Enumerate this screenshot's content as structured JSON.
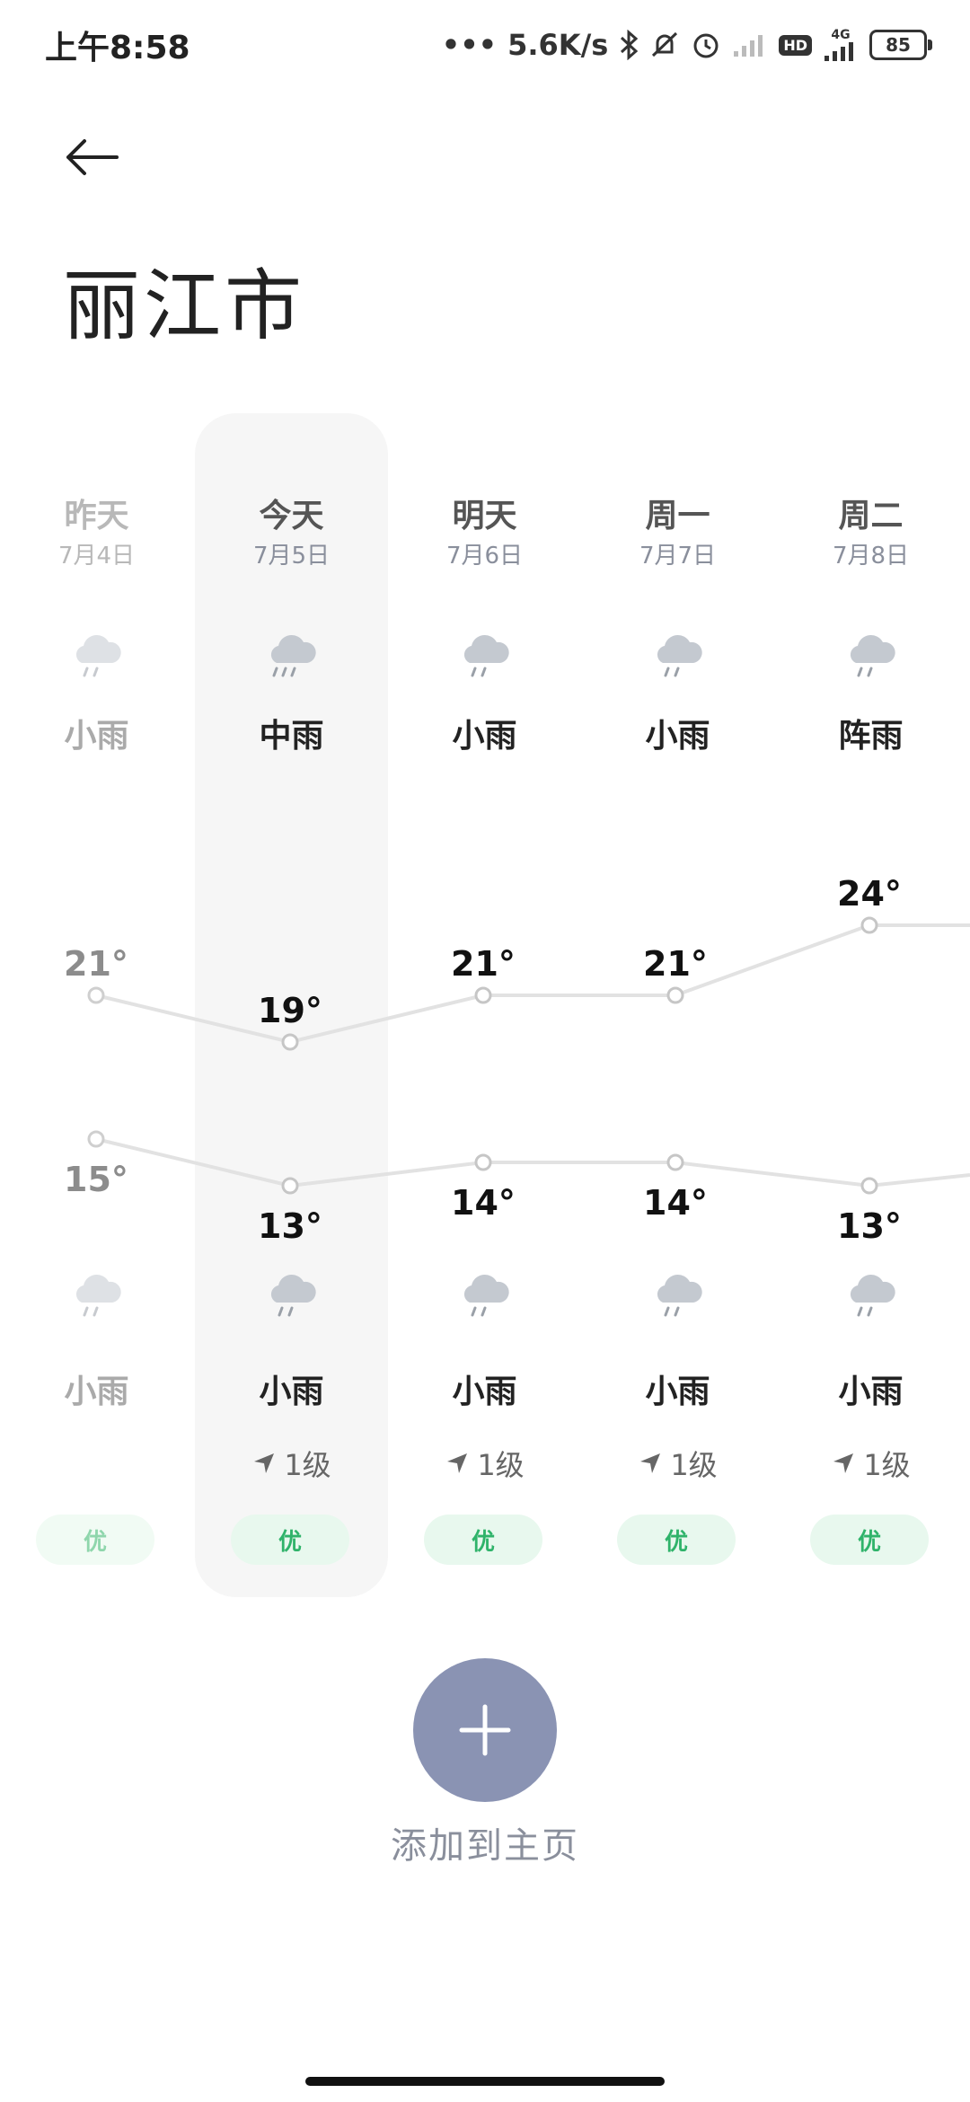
{
  "status_bar": {
    "time": "上午8:58",
    "speed": "5.6K/s",
    "hd": "HD",
    "network": "4G",
    "battery": "85"
  },
  "header": {
    "back_icon": "arrow-left-icon",
    "city": "丽江市"
  },
  "days": [
    {
      "name": "昨天",
      "date": "7月4日",
      "day_weather": "小雨",
      "high": "21°",
      "low": "15°",
      "night_weather": "小雨",
      "wind": "",
      "aqi": "优",
      "icon": "light-rain-icon"
    },
    {
      "name": "今天",
      "date": "7月5日",
      "day_weather": "中雨",
      "high": "19°",
      "low": "13°",
      "night_weather": "小雨",
      "wind": "1级",
      "aqi": "优",
      "icon": "moderate-rain-icon"
    },
    {
      "name": "明天",
      "date": "7月6日",
      "day_weather": "小雨",
      "high": "21°",
      "low": "14°",
      "night_weather": "小雨",
      "wind": "1级",
      "aqi": "优",
      "icon": "light-rain-icon"
    },
    {
      "name": "周一",
      "date": "7月7日",
      "day_weather": "小雨",
      "high": "21°",
      "low": "14°",
      "night_weather": "小雨",
      "wind": "1级",
      "aqi": "优",
      "icon": "light-rain-icon"
    },
    {
      "name": "周二",
      "date": "7月8日",
      "day_weather": "阵雨",
      "high": "24°",
      "low": "13°",
      "night_weather": "小雨",
      "wind": "1级",
      "aqi": "优",
      "icon": "shower-icon"
    }
  ],
  "chart_data": {
    "type": "line",
    "categories": [
      "昨天",
      "今天",
      "明天",
      "周一",
      "周二"
    ],
    "series": [
      {
        "values": [
          21,
          19,
          21,
          21,
          24
        ]
      },
      {
        "values": [
          15,
          13,
          14,
          14,
          13
        ]
      }
    ],
    "ylabel": ""
  },
  "add_button": {
    "icon": "plus-icon",
    "label": "添加到主页"
  },
  "colors": {
    "accent": "#8a93b3",
    "aqi_good_text": "#2fb36a",
    "aqi_good_bg": "#e8f8ee",
    "today_column": "#f6f6f6",
    "chart_line": "#e2e2e2"
  }
}
